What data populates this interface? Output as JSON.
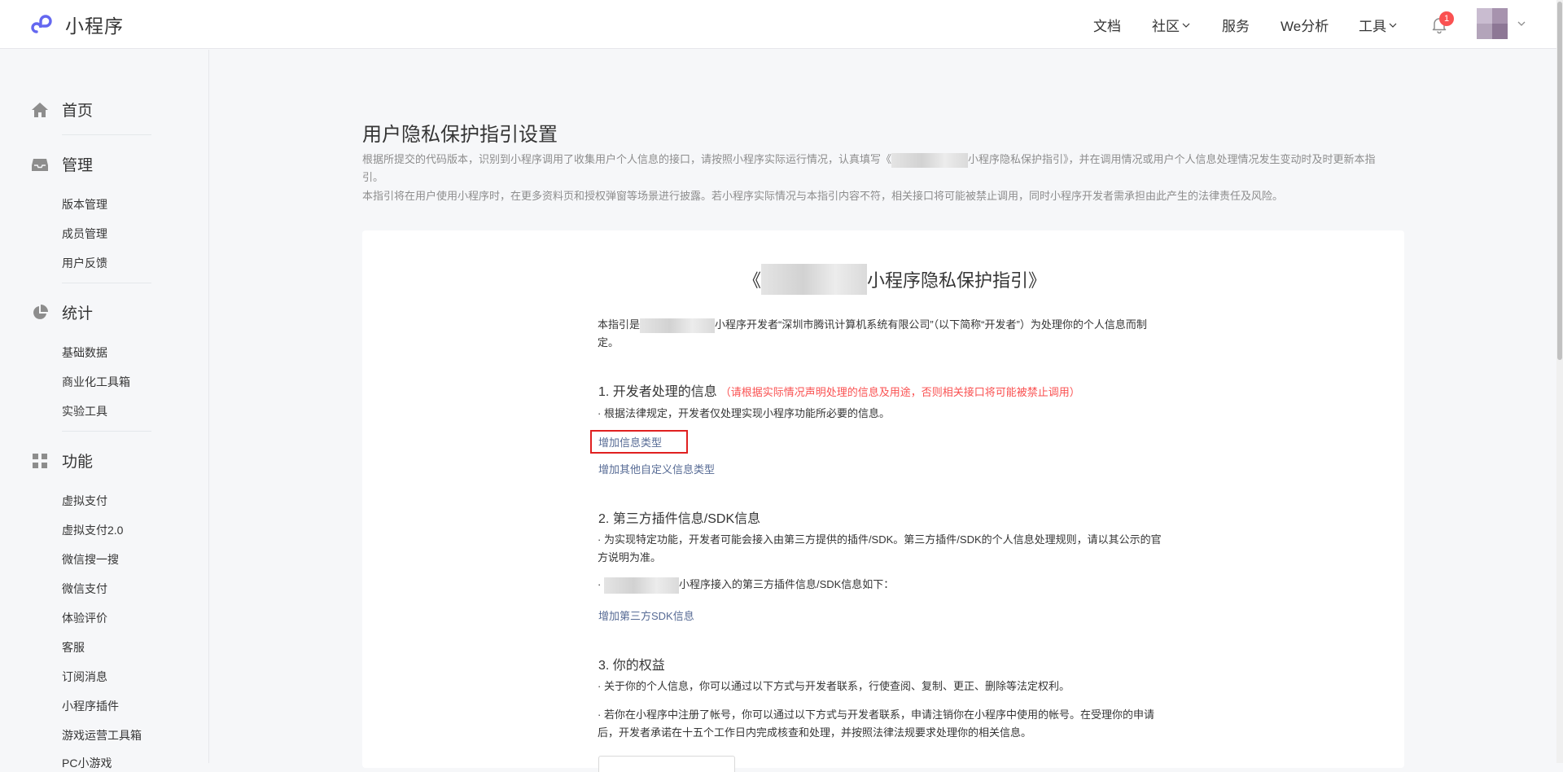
{
  "brand": {
    "name": "小程序"
  },
  "nav": {
    "docs": "文档",
    "community": "社区",
    "services": "服务",
    "analytics": "We分析",
    "tools": "工具",
    "notification_count": "1"
  },
  "sidebar": {
    "home": "首页",
    "manage": {
      "label": "管理",
      "items": [
        "版本管理",
        "成员管理",
        "用户反馈"
      ]
    },
    "stats": {
      "label": "统计",
      "items": [
        "基础数据",
        "商业化工具箱",
        "实验工具"
      ]
    },
    "features": {
      "label": "功能",
      "items": [
        "虚拟支付",
        "虚拟支付2.0",
        "微信搜一搜",
        "微信支付",
        "体验评价",
        "客服",
        "订阅消息",
        "小程序插件",
        "游戏运营工具箱",
        "PC小游戏"
      ]
    }
  },
  "main": {
    "title": "用户隐私保护指引设置",
    "desc1_part1": "根据所提交的代码版本，识别到小程序调用了收集用户个人信息的接口，请按照小程序实际运行情况，认真填写《",
    "desc1_part2": "小程序隐私保护指引》，并在调用情况或用户个人信息处理情况发生变动时及时更新本指引。",
    "desc2": "本指引将在用户使用小程序时，在更多资料页和授权弹窗等场景进行披露。若小程序实际情况与本指引内容不符，相关接口将可能被禁止调用，同时小程序开发者需承担由此产生的法律责任及风险。"
  },
  "doc": {
    "title_open": "《",
    "title_rest": "小程序隐私保护指引》",
    "intro_part1": "本指引是",
    "intro_part2": "小程序开发者“深圳市腾讯计算机系统有限公司”（以下简称“开发者”）为处理你的个人信息而制定。",
    "s1_title": "1. 开发者处理的信息",
    "s1_warn": "（请根据实际情况声明处理的信息及用途，否则相关接口将可能被禁止调用）",
    "s1_text": "· 根据法律规定，开发者仅处理实现小程序功能所必要的信息。",
    "s1_link1": "增加信息类型",
    "s1_link2": "增加其他自定义信息类型",
    "s2_title": "2. 第三方插件信息/SDK信息",
    "s2_text": "· 为实现特定功能，开发者可能会接入由第三方提供的插件/SDK。第三方插件/SDK的个人信息处理规则，请以其公示的官方说明为准。",
    "s2_text2_prefix": "· ",
    "s2_text2_rest": "小程序接入的第三方插件信息/SDK信息如下：",
    "s2_link": "增加第三方SDK信息",
    "s3_title": "3. 你的权益",
    "s3_text1": "· 关于你的个人信息，你可以通过以下方式与开发者联系，行使查阅、复制、更正、删除等法定权利。",
    "s3_text2": "· 若你在小程序中注册了帐号，你可以通过以下方式与开发者联系，申请注销你在小程序中使用的帐号。在受理你的申请后，开发者承诺在十五个工作日内完成核查和处理，并按照法律法规要求处理你的相关信息。"
  }
}
